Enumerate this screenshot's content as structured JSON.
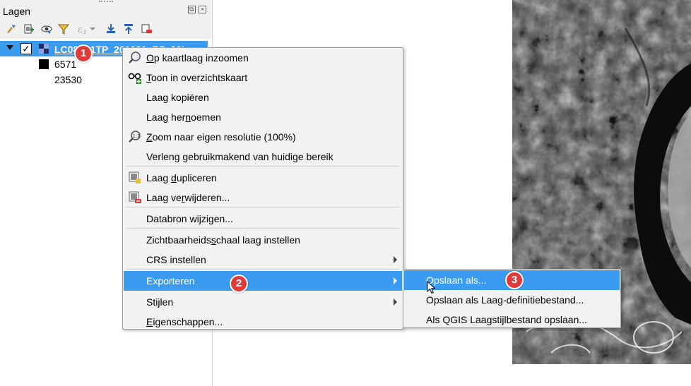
{
  "panel": {
    "title": "Lagen",
    "float_control": "⧉",
    "close_control": "×",
    "toolbar": [
      "style-manager-icon",
      "add-group-icon",
      "manage-visibility-icon",
      "filter-legend-icon",
      "expression-filter-icon",
      "expand-all-icon",
      "collapse-all-icon",
      "remove-layer-icon"
    ]
  },
  "layer": {
    "name": "LC08_L1TP_201031_B5_20L",
    "checked": "✓",
    "legend_min": "6571",
    "legend_max": "23530"
  },
  "context_menu": {
    "items": [
      {
        "pre": "",
        "accel": "O",
        "post": "p kaartlaag inzoomen",
        "icon": "zoom-to-layer-icon"
      },
      {
        "pre": "",
        "accel": "T",
        "post": "oon in overzichtskaart",
        "icon": "overview-glasses-icon"
      },
      {
        "pre": "Laag kopiëren",
        "accel": "",
        "post": "",
        "icon": ""
      },
      {
        "pre": "Laag her",
        "accel": "n",
        "post": "oemen",
        "icon": ""
      },
      {
        "pre": "",
        "accel": "Z",
        "post": "oom naar eigen resolutie (100%)",
        "icon": "zoom-native-resolution-icon"
      },
      {
        "pre": "Verleng gebruikmakend van huidige bereik",
        "accel": "",
        "post": "",
        "icon": ""
      },
      {
        "pre": "Laag ",
        "accel": "d",
        "post": "upliceren",
        "icon": "duplicate-layer-icon"
      },
      {
        "pre": "Laag ve",
        "accel": "r",
        "post": "wijderen...",
        "icon": "remove-layer-icon"
      },
      {
        "pre": "Databron wijzigen...",
        "accel": "",
        "post": "",
        "icon": ""
      },
      {
        "pre": "Zichtbaarheids",
        "accel": "s",
        "post": "chaal laag instellen",
        "icon": ""
      },
      {
        "pre": "CRS instellen",
        "accel": "",
        "post": "",
        "icon": ""
      },
      {
        "pre": "Exporteren",
        "accel": "",
        "post": "",
        "icon": ""
      },
      {
        "pre": "Stijlen",
        "accel": "",
        "post": "",
        "icon": ""
      },
      {
        "pre": "",
        "accel": "E",
        "post": "igenschappen...",
        "icon": ""
      }
    ]
  },
  "export_submenu": {
    "items": [
      {
        "label": "Opslaan als..."
      },
      {
        "label": "Opslaan als Laag-definitiebestand..."
      },
      {
        "label": "Als QGIS Laagstijlbestand opslaan..."
      }
    ]
  },
  "badges": [
    "1",
    "2",
    "3"
  ],
  "colors": {
    "highlight": "#3b9bf0",
    "badge": "#e03a3a",
    "menu_bg": "#f2f2f2",
    "panel_bg": "#f0f0f0"
  }
}
